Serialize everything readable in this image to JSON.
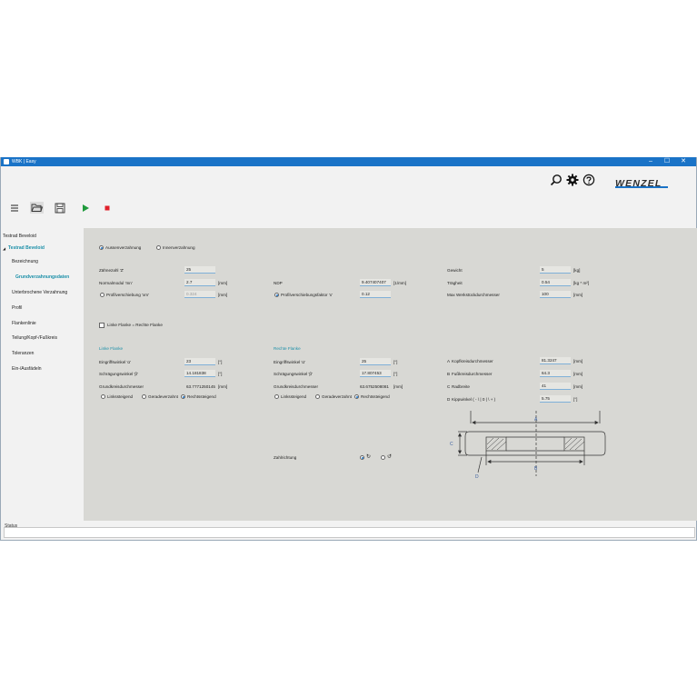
{
  "window": {
    "title": "WBK | Easy",
    "min": "–",
    "max": "☐",
    "close": "✕"
  },
  "logo": {
    "text": "WENZEL"
  },
  "sidebar": {
    "items": [
      {
        "label": "Testrad Beveloid"
      },
      {
        "label": "Testrad Beveloid"
      },
      {
        "label": "Bezeichnung"
      },
      {
        "label": "Grundverzahnungsdaten"
      },
      {
        "label": "Unterbrochene Verzahnung"
      },
      {
        "label": "Profil"
      },
      {
        "label": "Flankenlinie"
      },
      {
        "label": "Teilung/Kopf-/Fußkreis"
      },
      {
        "label": "Toleranzen"
      },
      {
        "label": "Ein-/Ausfädeln"
      }
    ],
    "expand_glyph": "◢"
  },
  "gear_type": {
    "outer": "Aussenverzahnung",
    "inner": "Innenverzahnung"
  },
  "col1": {
    "teeth_label": "Zähnezahl 'Z'",
    "teeth_value": "25",
    "module_label": "Normalmodul 'mn'",
    "module_value": "2.7",
    "module_unit": "[mm]",
    "shift_label": "Profilverschiebung 'xm'",
    "shift_value": "0.324",
    "shift_unit": "[mm]"
  },
  "col2": {
    "ndp_label": "NDP",
    "ndp_value": "9.407407407",
    "ndp_unit": "[1/mm]",
    "factor_label": "Profilverschiebungsfaktor 'x'",
    "factor_value": "0.12"
  },
  "col3": {
    "weight_label": "Gewicht",
    "weight_value": "5",
    "weight_unit": "[kg]",
    "inertia_label": "Trägheit",
    "inertia_value": "0.54",
    "inertia_unit": "[kg * m²]",
    "maxdia_label": "Max Werkstückdurchmesser",
    "maxdia_value": "100",
    "maxdia_unit": "[mm]"
  },
  "same_flank_label": "Linke Flanke = Rechte Flanke",
  "left_flank": {
    "title": "Linke Flanke",
    "pressure_label": "Eingriffswinkel 'α'",
    "pressure_value": "23",
    "pressure_unit": "[°]",
    "helix_label": "Schrägungswinkel 'β'",
    "helix_value": "14.181838",
    "helix_unit": "[°]",
    "base_label": "Grundkreisdurchmesser",
    "base_value": "63.7771250145",
    "base_unit": "[mm]",
    "opt_left": "Linkssteigend",
    "opt_straight": "Geradeverzahnt",
    "opt_right": "Rechtssteigend"
  },
  "right_flank": {
    "title": "Rechte Flanke",
    "pressure_label": "Eingriffswinkel 'α'",
    "pressure_value": "25",
    "pressure_unit": "[°]",
    "helix_label": "Schrägungswinkel 'β'",
    "helix_value": "17.807453",
    "helix_unit": "[°]",
    "base_label": "Grundkreisdurchmesser",
    "base_value": "63.6752508081",
    "base_unit": "[mm]",
    "opt_left": "Linkssteigend",
    "opt_straight": "Geradeverzahnt",
    "opt_right": "Rechtssteigend"
  },
  "dims": {
    "tip_label": "Kopfkreisdurchmesser",
    "tip_prefix": "A",
    "tip_value": "81.3247",
    "tip_unit": "[mm]",
    "root_label": "Fußkreisdurchmesser",
    "root_prefix": "B",
    "root_value": "64.3",
    "root_unit": "[mm]",
    "width_label": "Radbreite",
    "width_prefix": "C",
    "width_value": "41",
    "width_unit": "[mm]",
    "tilt_label": "Kippwinkel ( - \\ | 0 | \\ + )",
    "tilt_prefix": "D",
    "tilt_value": "5.75",
    "tilt_unit": "[°]"
  },
  "diagram_labels": {
    "a": "A",
    "b": "B",
    "c": "C",
    "d": "D"
  },
  "direction": {
    "label": "Zahlrichtung",
    "cw": "↻",
    "ccw": "↺"
  },
  "status": {
    "label": "Status"
  }
}
